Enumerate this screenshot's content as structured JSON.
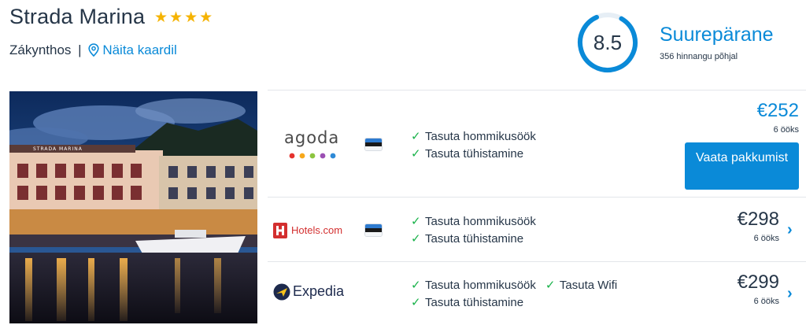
{
  "hotel": {
    "name": "Strada Marina",
    "stars": "★★★★",
    "location": "Zákynthos",
    "separator": "|",
    "map_link": "Näita kaardil"
  },
  "rating": {
    "score": "8.5",
    "word": "Suurepärane",
    "count_text": "356 hinnangu põhjal",
    "ring_fraction": 0.85
  },
  "photo": {
    "sign_text": "STRADA MARINA"
  },
  "offers": [
    {
      "provider": "agoda",
      "flag": "Estonia",
      "perks_line1": [
        "Tasuta hommikusöök"
      ],
      "perks_line2": [
        "Tasuta tühistamine"
      ],
      "price": "€252",
      "nights": "6 ööks",
      "button": "Vaata pakkumist"
    },
    {
      "provider": "Hotels.com",
      "flag": "Estonia",
      "perks_line1": [
        "Tasuta hommikusöök"
      ],
      "perks_line2": [
        "Tasuta tühistamine"
      ],
      "price": "€298",
      "nights": "6 ööks"
    },
    {
      "provider": "Expedia",
      "flag": "",
      "perks_line1": [
        "Tasuta hommikusöök",
        "Tasuta Wifi"
      ],
      "perks_line2": [
        "Tasuta tühistamine"
      ],
      "price": "€299",
      "nights": "6 ööks"
    }
  ],
  "colors": {
    "accent": "#0a8ad8",
    "star": "#f5b301",
    "check": "#19b24a",
    "text": "#263648"
  }
}
